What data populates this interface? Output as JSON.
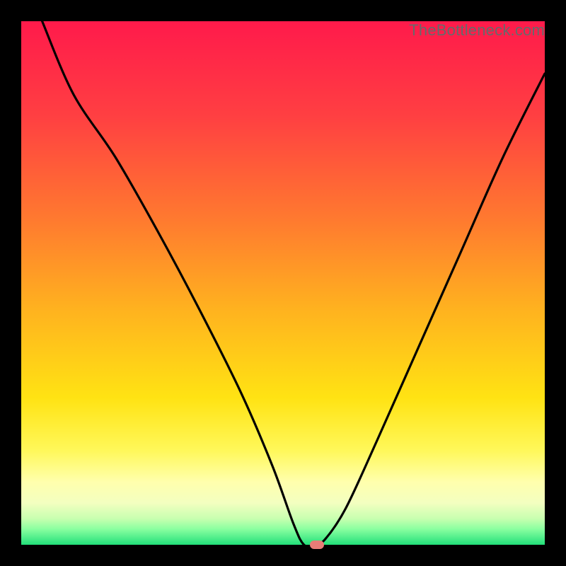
{
  "watermark": "TheBottleneck.com",
  "chart_data": {
    "type": "line",
    "title": "",
    "xlabel": "",
    "ylabel": "",
    "xlim": [
      0,
      100
    ],
    "ylim": [
      0,
      100
    ],
    "series": [
      {
        "name": "curve",
        "x": [
          4,
          10,
          18,
          26,
          34,
          42,
          48,
          52,
          54,
          56,
          58,
          62,
          68,
          76,
          84,
          92,
          100
        ],
        "values": [
          100,
          86,
          74,
          60,
          45,
          29,
          15,
          4,
          0,
          0,
          1,
          7,
          20,
          38,
          56,
          74,
          90
        ]
      }
    ],
    "marker": {
      "x": 56.5,
      "y": 0
    },
    "gradient_stops": [
      {
        "offset": 0,
        "color": "#ff1a4b"
      },
      {
        "offset": 18,
        "color": "#ff3f42"
      },
      {
        "offset": 38,
        "color": "#ff7a2f"
      },
      {
        "offset": 55,
        "color": "#ffb21f"
      },
      {
        "offset": 72,
        "color": "#ffe313"
      },
      {
        "offset": 82,
        "color": "#fff85a"
      },
      {
        "offset": 88,
        "color": "#ffffad"
      },
      {
        "offset": 92,
        "color": "#f3ffc0"
      },
      {
        "offset": 95,
        "color": "#c8ffb0"
      },
      {
        "offset": 97,
        "color": "#8affa0"
      },
      {
        "offset": 100,
        "color": "#22e07a"
      }
    ],
    "marker_color": "#e87c77",
    "line_color": "#000000"
  }
}
